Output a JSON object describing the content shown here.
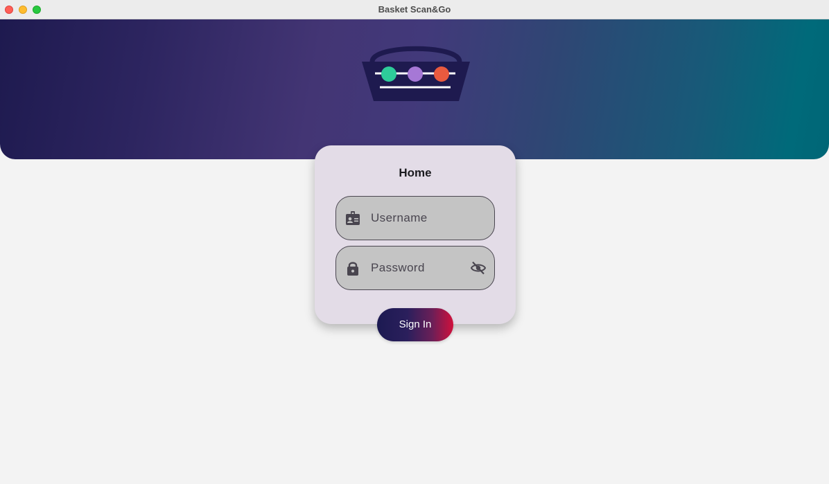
{
  "window": {
    "title": "Basket Scan&Go"
  },
  "banner": {
    "logo_icon": "basket-logo-icon",
    "logo_dot_colors": [
      "#2ecc9a",
      "#a678d6",
      "#e95a3f"
    ],
    "gradient_colors": [
      "#1e1a4f",
      "#433574",
      "#006a7a"
    ]
  },
  "login": {
    "title": "Home",
    "username": {
      "icon": "badge-icon",
      "placeholder": "Username",
      "value": ""
    },
    "password": {
      "icon": "lock-icon",
      "placeholder": "Password",
      "value": "",
      "toggle_icon": "visibility-off-icon"
    },
    "signin_label": "Sign In",
    "signin_gradient": [
      "#1c1a52",
      "#d0103c"
    ]
  },
  "colors": {
    "background": "#f3f3f3",
    "card": "#e3dce7",
    "field": "#c4c4c4"
  }
}
